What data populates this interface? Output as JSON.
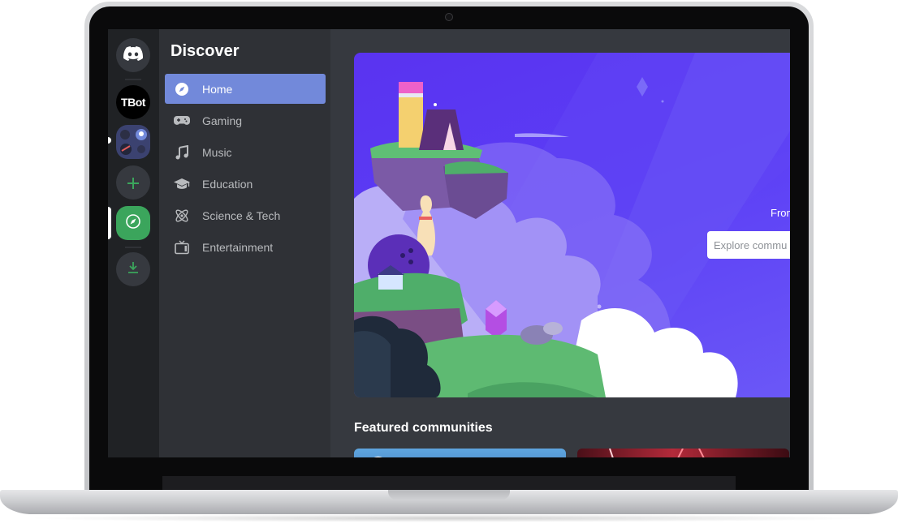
{
  "sidebar": {
    "title": "Discover",
    "items": [
      {
        "label": "Home",
        "icon": "compass-icon",
        "active": true
      },
      {
        "label": "Gaming",
        "icon": "gamepad-icon",
        "active": false
      },
      {
        "label": "Music",
        "icon": "music-note-icon",
        "active": false
      },
      {
        "label": "Education",
        "icon": "graduation-cap-icon",
        "active": false
      },
      {
        "label": "Science & Tech",
        "icon": "atom-icon",
        "active": false
      },
      {
        "label": "Entertainment",
        "icon": "tv-icon",
        "active": false
      }
    ]
  },
  "server_rail": {
    "servers": [
      {
        "name": "TBot",
        "label": "TBot"
      }
    ]
  },
  "hero": {
    "text": "From",
    "search_placeholder": "Explore commu"
  },
  "featured": {
    "title": "Featured communities"
  },
  "colors": {
    "accent": "#7289da",
    "green": "#3ba55c",
    "hero": "#5b3df5"
  }
}
